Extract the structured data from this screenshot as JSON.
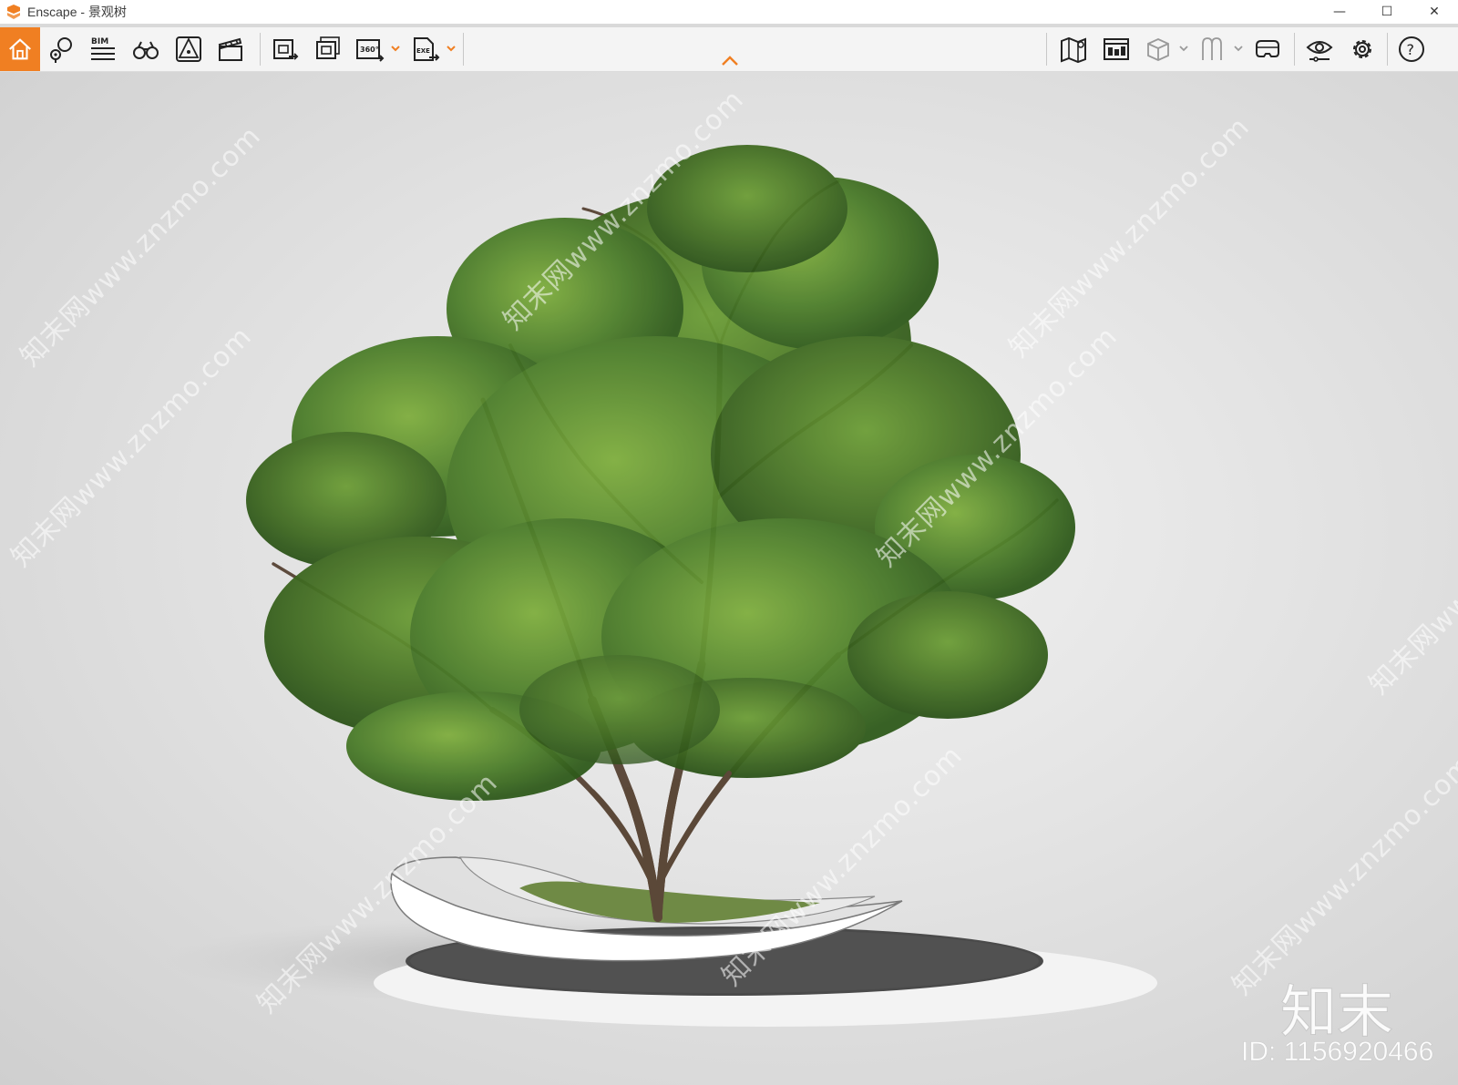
{
  "window": {
    "app_name": "Enscape",
    "separator": " - ",
    "document_name": "景观树",
    "minimize_glyph": "—",
    "maximize_glyph": "☐",
    "close_glyph": "✕"
  },
  "toolbar": {
    "left_tools": [
      {
        "icon": "home-icon"
      },
      {
        "icon": "location-pin-icon"
      },
      {
        "icon": "bim-icon",
        "label": "BIM"
      },
      {
        "icon": "binoculars-icon"
      },
      {
        "icon": "perspective-icon"
      },
      {
        "icon": "clapperboard-icon"
      }
    ],
    "export_tools": [
      {
        "icon": "render-screenshot-icon"
      },
      {
        "icon": "batch-render-icon"
      },
      {
        "icon": "panorama-360-icon",
        "label": "360°"
      },
      {
        "icon": "export-exe-icon",
        "label": "EXE"
      }
    ],
    "right_tools": [
      {
        "icon": "map-icon"
      },
      {
        "icon": "asset-library-icon"
      },
      {
        "icon": "cube-view-icon"
      },
      {
        "icon": "section-view-icon"
      },
      {
        "icon": "vr-headset-icon"
      },
      {
        "icon": "visual-settings-eye-icon"
      },
      {
        "icon": "settings-gear-icon"
      },
      {
        "icon": "help-icon",
        "label": "?"
      }
    ],
    "accent_color": "#f07f22"
  },
  "viewport": {
    "watermark_text": "知末网www.znzmo.com",
    "brand_mark": "知末",
    "id_label": "ID: 1156920466"
  }
}
